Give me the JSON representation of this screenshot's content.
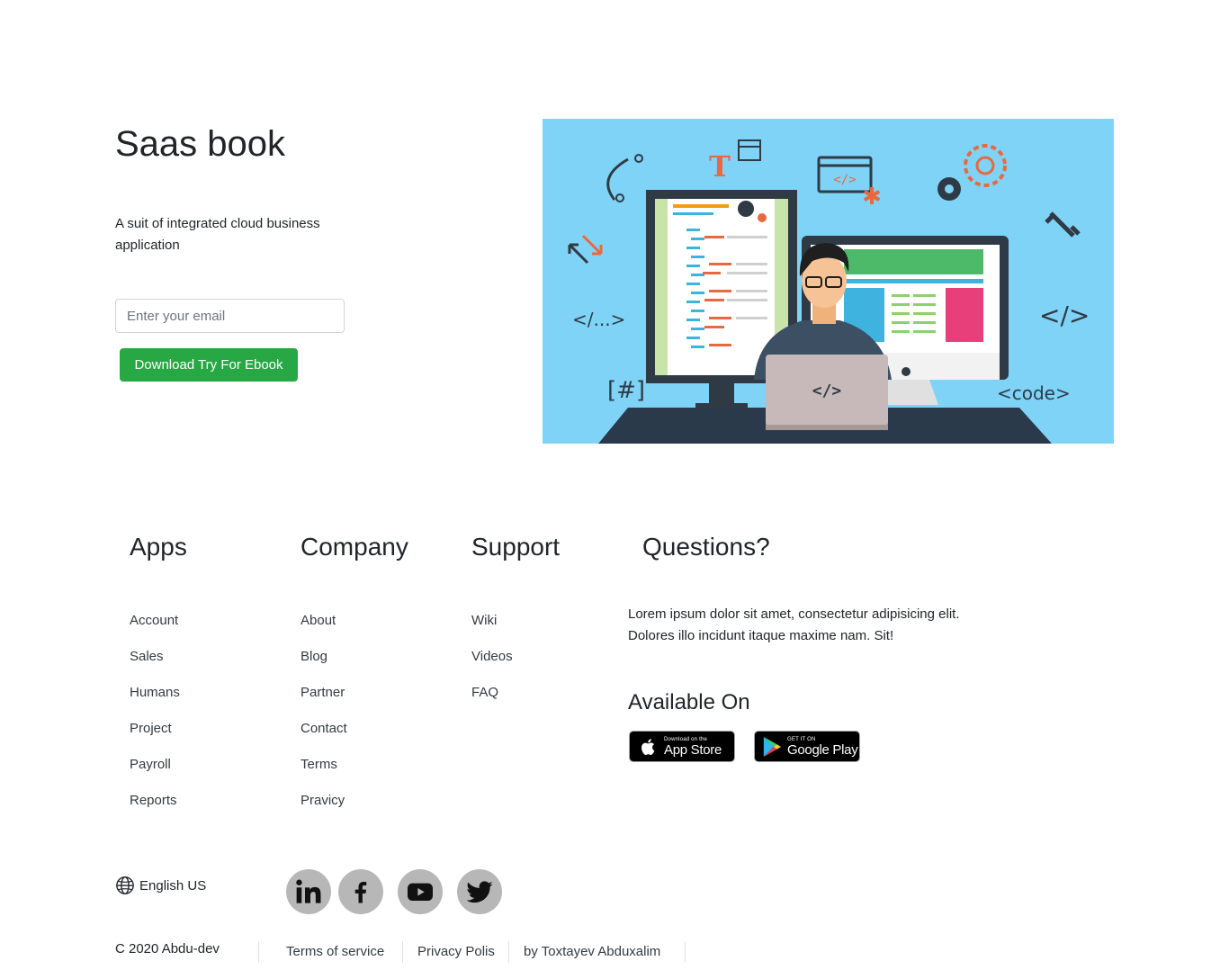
{
  "hero": {
    "title": "Saas book",
    "subtitle": "A suit of integrated cloud business application",
    "email_placeholder": "Enter your email",
    "download_label": "Download Try For Ebook"
  },
  "illustration": {
    "background_color": "#7fd3f7",
    "tags": {
      "code_dots": "</...>",
      "code_slash": "</>",
      "hash": "[#]",
      "code_word": "<code>",
      "laptop_code": "</>",
      "window_code": "</>",
      "letter_t": "T"
    }
  },
  "footer": {
    "columns": [
      {
        "title": "Apps",
        "items": [
          "Account",
          "Sales",
          "Humans",
          "Project",
          "Payroll",
          "Reports"
        ]
      },
      {
        "title": "Company",
        "items": [
          "About",
          "Blog",
          "Partner",
          "Contact",
          "Terms",
          "Pravicy"
        ]
      },
      {
        "title": "Support",
        "items": [
          "Wiki",
          "Videos",
          "FAQ"
        ]
      }
    ],
    "questions": {
      "title": "Questions?",
      "text": "Lorem ipsum dolor sit amet, consectetur adipisicing elit. Dolores illo incidunt itaque maxime nam. Sit!"
    },
    "available": {
      "title": "Available On",
      "app_store": {
        "small": "Download on the",
        "big": "App Store"
      },
      "google_play": {
        "small": "GET IT ON",
        "big": "Google Play"
      }
    },
    "language": "English US",
    "social": [
      "linkedin-icon",
      "facebook-icon",
      "youtube-icon",
      "twitter-icon"
    ],
    "copyright": "C 2020 Abdu-dev",
    "links": [
      "Terms of service",
      "Privacy Polis",
      "by Toxtayev Abduxalim"
    ]
  },
  "colors": {
    "accent_green": "#28a745",
    "social_bg": "#b7b7b7",
    "illustration_bg": "#7fd3f7"
  }
}
